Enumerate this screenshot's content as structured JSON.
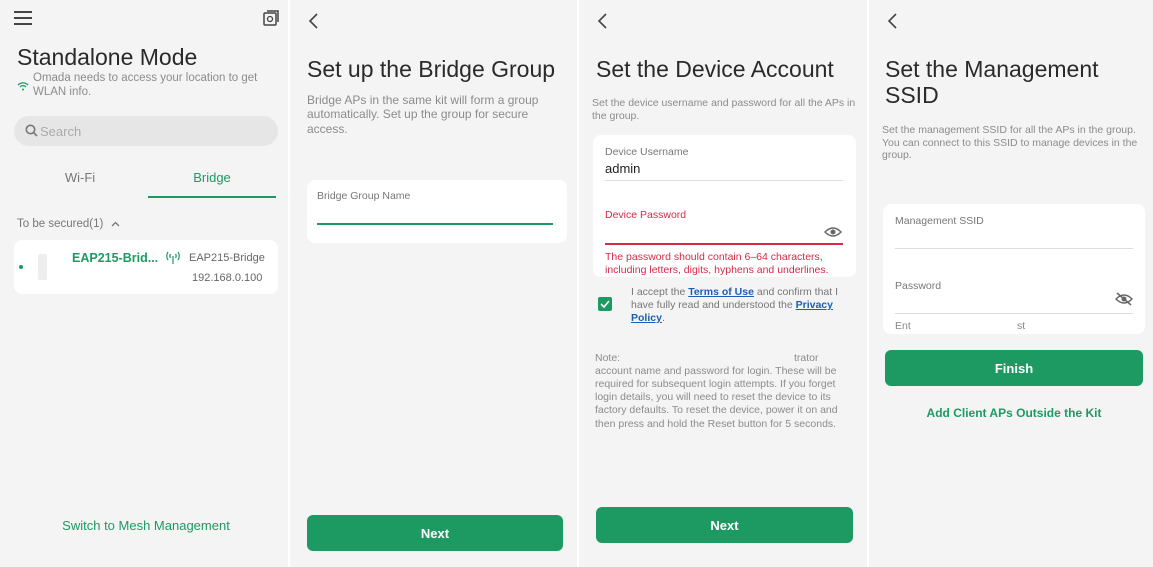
{
  "colors": {
    "accent": "#1d9a62",
    "error": "#d62a46",
    "link": "#1a5fb4"
  },
  "screen1": {
    "title": "Standalone Mode",
    "location_note": "Omada needs to access your location to get WLAN info.",
    "search_placeholder": "Search",
    "tabs": [
      {
        "label": "Wi-Fi",
        "active": false
      },
      {
        "label": "Bridge",
        "active": true
      }
    ],
    "section_label": "To be secured(1)",
    "device": {
      "name": "EAP215-Brid...",
      "model": "EAP215-Bridge",
      "ip": "192.168.0.100"
    },
    "switch_link": "Switch to Mesh Management"
  },
  "screen2": {
    "title": "Set up the Bridge Group",
    "subtitle": "Bridge APs in the same kit will form a group automatically. Set up the group for secure access.",
    "field_label": "Bridge Group Name",
    "field_value": "",
    "next_label": "Next"
  },
  "screen3": {
    "title": "Set the Device Account",
    "subtitle": "Set the device username and password for all the APs in the group.",
    "username_label": "Device Username",
    "username_value": "admin",
    "password_label": "Device Password",
    "password_error": "The password should contain 6–64 characters, including letters, digits, hyphens and underlines.",
    "accept_prefix": "I accept the ",
    "terms_link": "Terms of Use",
    "accept_middle": " and confirm that I have fully read and understood the ",
    "privacy_link": "Privacy Policy",
    "accept_suffix": ".",
    "note_line1_start": "Note:",
    "note_line1_end": "trator",
    "note_rest": "account name and password for login. These will be required for subsequent login attempts. If you forget login details, you will need to reset the device to its factory defaults. To reset the device, power it on and then press and hold the Reset button for 5 seconds.",
    "next_label": "Next"
  },
  "screen4": {
    "title": "Set the Management SSID",
    "subtitle": "Set the management SSID for all the APs in the group. You can connect to this SSID to manage devices in the group.",
    "ssid_label": "Management SSID",
    "password_label": "Password",
    "partial_left": "Ent",
    "partial_right": "st",
    "finish_label": "Finish",
    "add_link": "Add Client APs Outside the Kit"
  }
}
